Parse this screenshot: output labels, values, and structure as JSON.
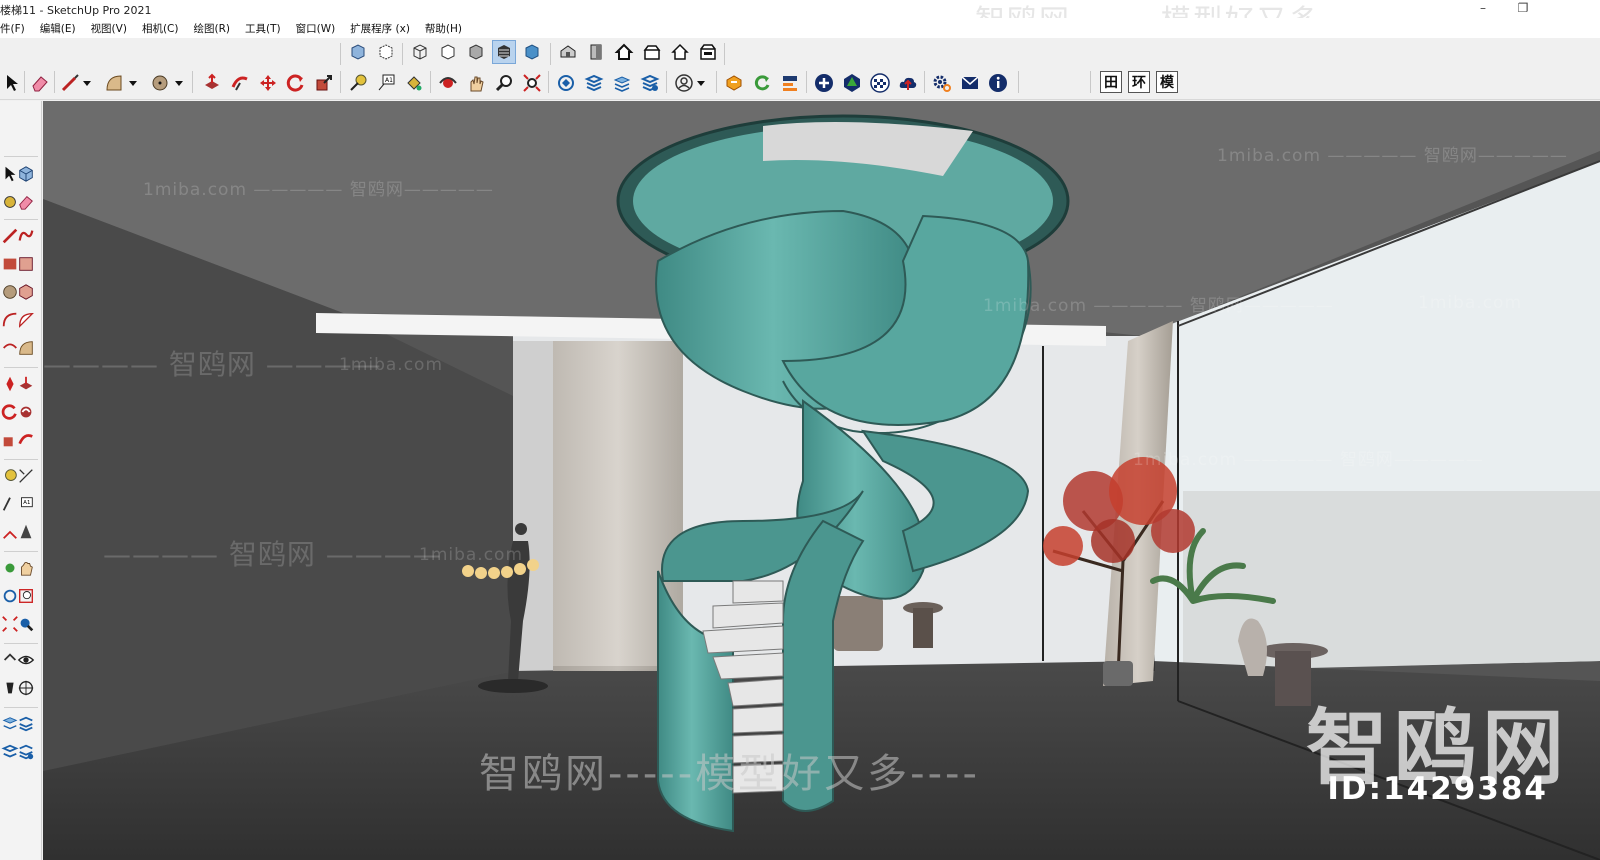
{
  "window": {
    "title": "楼梯11 - SketchUp Pro 2021",
    "controls": {
      "minimize": "–",
      "restore": "❐",
      "close": ""
    }
  },
  "menu": {
    "items": [
      "件(F)",
      "编辑(E)",
      "视图(V)",
      "相机(C)",
      "绘图(R)",
      "工具(T)",
      "窗口(W)",
      "扩展程序 (x)",
      "帮助(H)"
    ]
  },
  "toolbar_top": {
    "icons": [
      "xray-icon",
      "back-edges-icon",
      "wireframe-icon",
      "hidden-line-icon",
      "shaded-icon",
      "shaded-textures-icon",
      "monochrome-icon",
      "iso-view-icon",
      "top-view-icon",
      "front-view-icon",
      "right-view-icon",
      "back-view-icon",
      "left-view-icon"
    ],
    "active": "shaded-textures-icon"
  },
  "toolbar_main": {
    "icons": [
      "select-icon",
      "eraser-icon",
      "line-icon",
      "arc-icon",
      "circle-icon",
      "push-pull-icon",
      "follow-me-icon",
      "move-icon",
      "rotate-icon",
      "scale-icon",
      "tape-measure-icon",
      "text-icon",
      "paint-bucket-icon",
      "orbit-icon",
      "pan-icon",
      "zoom-icon",
      "zoom-extents-icon",
      "3d-warehouse-icon",
      "extension-warehouse-icon",
      "layout-icon",
      "extension-manager-icon",
      "user-icon",
      "sketchup-icon",
      "refresh-icon",
      "export-icon",
      "add-location-icon",
      "tree-icon",
      "checker-icon",
      "cloud-upload-icon",
      "settings-icon",
      "mail-icon",
      "info-icon"
    ],
    "text_buttons": [
      "田",
      "环",
      "模"
    ]
  },
  "left_palette": {
    "icons": [
      "select-icon",
      "component-icon",
      "paint-icon",
      "eraser-icon",
      "line-icon",
      "freehand-icon",
      "rectangle-icon",
      "rotated-rect-icon",
      "circle-icon",
      "polygon-icon",
      "arc-icon",
      "pie-icon",
      "push-pull-icon",
      "follow-me-icon",
      "offset-icon",
      "scale-icon",
      "tape-icon",
      "dimension-icon",
      "protractor-icon",
      "text-icon",
      "axes-icon",
      "3d-text-icon",
      "orbit-icon",
      "pan-icon",
      "zoom-icon",
      "zoom-window-icon",
      "zoom-extents-icon",
      "position-camera-icon",
      "look-around-icon",
      "walk-icon",
      "section-icon",
      "section-display-icon"
    ]
  },
  "watermarks": {
    "top": "智鸥网-------模型好又多-------",
    "site": "1miba.com",
    "brand_line": "———— 智鸥网 ————",
    "brand_line_left": "1miba.com ————— 智鸥网—————",
    "brand_line_right": "1miba.com ————— 智鸥网—————",
    "big": "智鸥网",
    "id": "ID:1429384",
    "bottom": "智鸥网-----模型好又多----"
  },
  "colors": {
    "stair": "#62aea6",
    "stair_dark": "#3f8a84",
    "floor": "#3b3b3b",
    "ceiling": "#6e6e6e",
    "wall_left": "#4d4d4d",
    "outdoor": "#e8ecee",
    "tree": "#c9302c"
  }
}
